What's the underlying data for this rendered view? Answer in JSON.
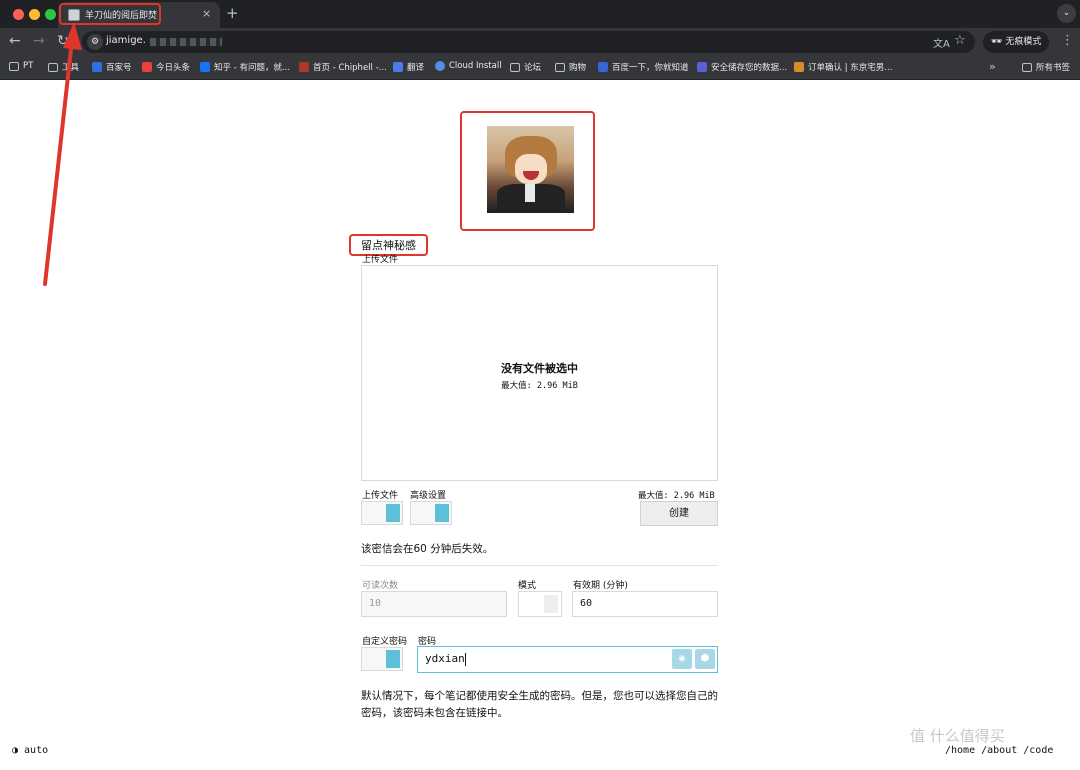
{
  "browser": {
    "tab_title": "羊刀仙的阅后即焚",
    "tab_close": "×",
    "new_tab": "+",
    "url_text": "jiamige.",
    "incognito_label": "无痕模式",
    "bookmarks": [
      {
        "label": "PT",
        "icon": "folder-icon"
      },
      {
        "label": "工具",
        "icon": "folder-icon"
      },
      {
        "label": "百家号",
        "icon": "baijiahao-icon",
        "color": "#2f6fde"
      },
      {
        "label": "今日头条",
        "icon": "toutiao-icon",
        "color": "#e8423a"
      },
      {
        "label": "知乎 - 有问题，就...",
        "icon": "zhihu-icon",
        "color": "#1772f6"
      },
      {
        "label": "首页 - Chiphell -...",
        "icon": "chiphell-icon",
        "color": "#a93a2c"
      },
      {
        "label": "翻译",
        "icon": "translate-icon",
        "color": "#4a7be6"
      },
      {
        "label": "Cloud Install",
        "icon": "cloud-icon",
        "color": "#4f8fe6"
      },
      {
        "label": "论坛",
        "icon": "folder-icon"
      },
      {
        "label": "购物",
        "icon": "folder-icon"
      },
      {
        "label": "百度一下，你就知道",
        "icon": "baidu-icon",
        "color": "#3b63d6"
      },
      {
        "label": "安全储存您的数据...",
        "icon": "storage-icon",
        "color": "#5a5fd6"
      },
      {
        "label": "订单确认 | 东京宅男...",
        "icon": "order-icon",
        "color": "#d88b2a"
      }
    ],
    "all_bookmarks": "所有书签"
  },
  "page": {
    "site_name": "留点神秘感",
    "upload_section_label": "上传文件",
    "dropzone_title": "没有文件被选中",
    "dropzone_max": "最大值: 2.96 MiB",
    "toggle_upload_label": "上传文件",
    "toggle_advanced_label": "高级设置",
    "max_right": "最大值: 2.96 MiB",
    "create_button": "创建",
    "expire_note": "该密信会在60 分钟后失效。",
    "read_count_label": "可读次数",
    "read_count_placeholder": "10",
    "mode_label": "模式",
    "expiry_label": "有效期 (分钟)",
    "expiry_value": "60",
    "custom_password_label": "自定义密码",
    "password_label": "密码",
    "password_value": "ydxian",
    "help_text": "默认情况下，每个笔记都使用安全生成的密码。但是，您也可以选择您自己的密码，该密码未包含在链接中。",
    "footer_theme": "◑ auto",
    "footer_links": "/home /about /code"
  },
  "colors": {
    "accent": "#5bc0d8",
    "annotation": "#e0352b"
  }
}
